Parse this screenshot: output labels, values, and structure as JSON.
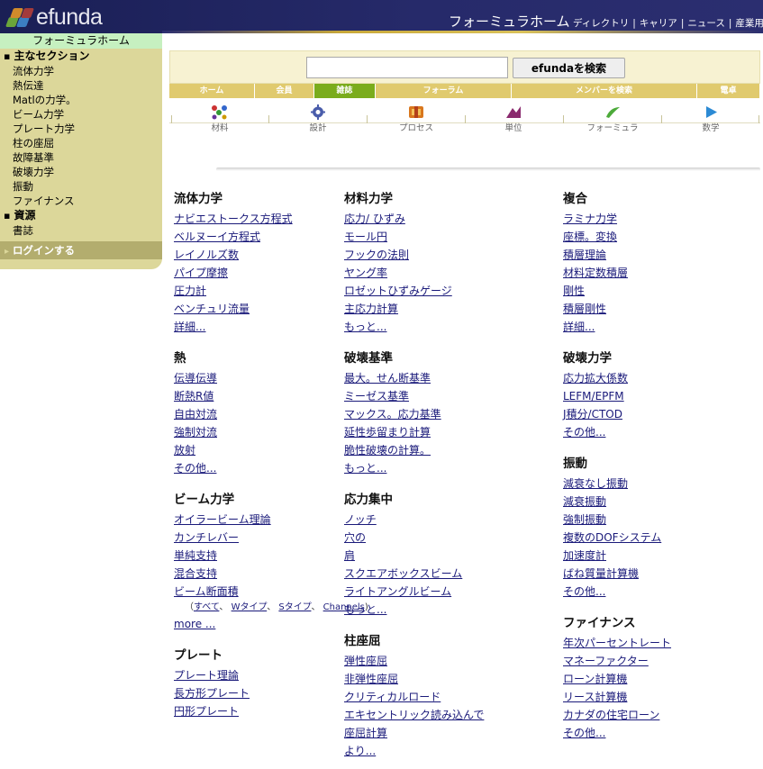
{
  "header": {
    "logo_text": "efunda",
    "title": "フォーミュラホーム",
    "links": [
      "ディレクトリ",
      "キャリア",
      "ニュース",
      "産業用"
    ]
  },
  "sidebar": {
    "home": "フォーミュラホーム",
    "section_main": "主なセクション",
    "items_main": [
      "流体力学",
      "熱伝達",
      "Matlの力学。",
      "ビーム力学",
      "プレート力学",
      "柱の座屈",
      "故障基準",
      "破壊力学",
      "振動",
      "ファイナンス"
    ],
    "section_resources": "資源",
    "items_resources": [
      "書誌"
    ],
    "login": "ログインする"
  },
  "search": {
    "placeholder": "",
    "button": "efundaを検索"
  },
  "navtabs": [
    {
      "label": "ホーム",
      "active": false
    },
    {
      "label": "会員",
      "active": false
    },
    {
      "label": "雑誌",
      "active": true
    },
    {
      "label": "フォーラム",
      "active": false
    },
    {
      "label": "メンバーを検索",
      "active": false
    },
    {
      "label": "電卓",
      "active": false
    }
  ],
  "icons": [
    {
      "name": "materials-icon",
      "label": "材料"
    },
    {
      "name": "design-icon",
      "label": "設計"
    },
    {
      "name": "process-icon",
      "label": "プロセス"
    },
    {
      "name": "units-icon",
      "label": "単位"
    },
    {
      "name": "formula-icon",
      "label": "フォーミュラ"
    },
    {
      "name": "math-icon",
      "label": "数学"
    }
  ],
  "colors": {
    "header_bg": "#262a6a",
    "sidebar_bg": "#dcd79a",
    "tab_bg": "#e0ca6e",
    "tab_active": "#7aac1c",
    "link": "#1a1a7a"
  },
  "col1": {
    "fluid": {
      "title": "流体力学",
      "links": [
        "ナビエストークス方程式",
        "ベルヌーイ方程式",
        "レイノルズ数",
        "パイプ摩擦",
        "圧力計",
        "ベンチュリ流量",
        "詳細..."
      ]
    },
    "heat": {
      "title": "熱",
      "links": [
        "伝導伝導",
        "断熱R値",
        "自由対流",
        "強制対流",
        "放射",
        "その他..."
      ]
    },
    "beam": {
      "title": "ビーム力学",
      "links": [
        "オイラービーム理論",
        "カンチレバー",
        "単純支持",
        "混合支持",
        "ビーム断面積"
      ],
      "sub_open": "（",
      "sub": [
        "すべて",
        "Wタイプ",
        "Sタイプ",
        "Channels"
      ],
      "sub_close": ")",
      "more": "more ..."
    },
    "plate": {
      "title": "プレート",
      "links": [
        "プレート理論",
        "長方形プレート",
        "円形プレート"
      ]
    }
  },
  "col2": {
    "materials": {
      "title": "材料力学",
      "links": [
        "応力/ ひずみ",
        "モール円",
        "フックの法則",
        "ヤング率",
        "ロゼットひずみゲージ",
        "主応力計算",
        "もっと..."
      ]
    },
    "failure": {
      "title": "破壊基準",
      "links": [
        "最大。せん断基準",
        "ミーゼス基準",
        "マックス。応力基準",
        "延性歩留まり計算",
        "脆性破壊の計算。",
        "もっと..."
      ]
    },
    "stressconc": {
      "title": "応力集中",
      "links": [
        "ノッチ",
        "穴の",
        "肩",
        "スクエアボックスビーム",
        "ライトアングルビーム",
        "もっと..."
      ]
    },
    "buckling": {
      "title": "柱座屈",
      "links": [
        "弾性座屈",
        "非弾性座屈",
        "クリティカルロード",
        "エキセントリック読み込んで",
        "座屈計算",
        "より..."
      ]
    }
  },
  "col3": {
    "composite": {
      "title": "複合",
      "links": [
        "ラミナ力学",
        "座標。変換",
        "積層理論",
        "材料定数積層",
        "剛性",
        "積層剛性",
        "詳細..."
      ]
    },
    "fracture": {
      "title": "破壊力学",
      "links": [
        "応力拡大係数",
        "LEFM/EPFM",
        "J積分/CTOD",
        "その他..."
      ]
    },
    "vibration": {
      "title": "振動",
      "links": [
        "減衰なし振動",
        "減衰振動",
        "強制振動",
        "複数のDOFシステム",
        "加速度計",
        "ばね質量計算機",
        "その他..."
      ]
    },
    "finance": {
      "title": "ファイナンス",
      "links": [
        "年次パーセントレート",
        "マネーファクター",
        "ローン計算機",
        "リース計算機",
        "カナダの住宅ローン",
        "その他..."
      ]
    }
  }
}
